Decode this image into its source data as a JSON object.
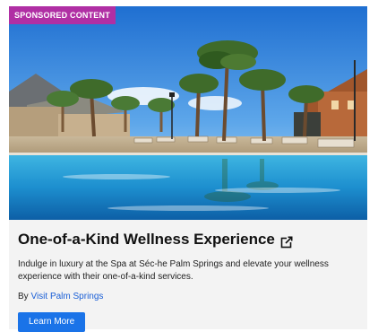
{
  "ad": {
    "badge": "SPONSORED CONTENT",
    "title": "One-of-a-Kind Wellness Experience",
    "description": "Indulge in luxury at the Spa at Séc-he Palm Springs and elevate your wellness experience with their one-of-a-kind services.",
    "by_prefix": "By ",
    "sponsor_link": "Visit Palm Springs",
    "cta_label": "Learn More",
    "colors": {
      "badge": "#b02fa4",
      "button": "#1a73e8",
      "link": "#1a5fd6"
    },
    "icons": [
      "external-link-icon"
    ]
  }
}
